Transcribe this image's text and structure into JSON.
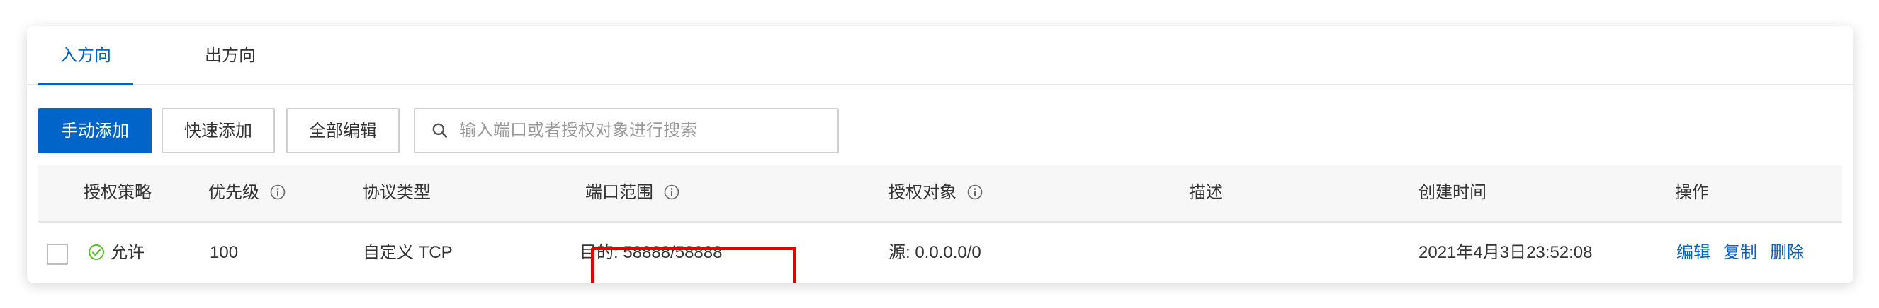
{
  "tabs": [
    {
      "label": "入方向",
      "active": true
    },
    {
      "label": "出方向",
      "active": false
    }
  ],
  "toolbar": {
    "add_manual_label": "手动添加",
    "quick_add_label": "快速添加",
    "edit_all_label": "全部编辑",
    "search_placeholder": "输入端口或者授权对象进行搜索",
    "search_value": ""
  },
  "table": {
    "columns": [
      "授权策略",
      "优先级",
      "协议类型",
      "端口范围",
      "授权对象",
      "描述",
      "创建时间",
      "操作"
    ],
    "columns_with_info": [
      "优先级",
      "端口范围",
      "授权对象"
    ],
    "rows": [
      {
        "policy": "允许",
        "priority": "100",
        "protocol": "自定义 TCP",
        "port_range": "目的: 58888/58888",
        "auth_object": "源: 0.0.0.0/0",
        "description": "",
        "created": "2021年4月3日23:52:08",
        "actions": [
          "编辑",
          "复制",
          "删除"
        ]
      }
    ]
  },
  "colors": {
    "accent": "#0064c8",
    "allow_green": "#52c41a",
    "highlight_red": "#e60000"
  },
  "icons": {
    "search": "search-icon",
    "info": "info-circle-icon",
    "allow": "check-circle-icon"
  }
}
